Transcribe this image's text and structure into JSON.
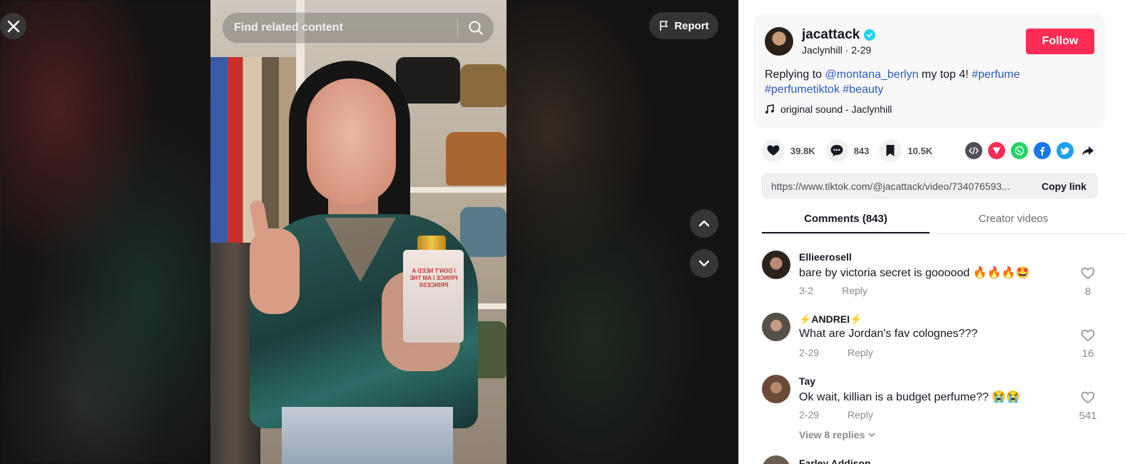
{
  "search": {
    "placeholder": "Find related content"
  },
  "report": {
    "label": "Report"
  },
  "video": {
    "bottle_text": "I DON'T NEED A PRINCE I AM THE PRINCESS"
  },
  "author": {
    "username": "jacattack",
    "display_name": "Jaclynhill",
    "date": "2-29",
    "subline": "Jaclynhill · 2-29",
    "follow_label": "Follow"
  },
  "caption": {
    "prefix": "Replying to ",
    "mention": "@montana_berlyn",
    "text": " my top 4! ",
    "tags": [
      "#perfume",
      "#perfumetiktok",
      "#beauty"
    ]
  },
  "sound": {
    "label": "original sound - Jaclynhill"
  },
  "stats": {
    "likes": "39.8K",
    "comments": "843",
    "saves": "10.5K"
  },
  "share": {
    "icons": [
      "embed-icon",
      "send-icon",
      "whatsapp-icon",
      "facebook-icon",
      "twitter-icon",
      "share-arrow-icon"
    ]
  },
  "link": {
    "url": "https://www.tiktok.com/@jacattack/video/734076593...",
    "copy_label": "Copy link"
  },
  "tabs": [
    {
      "label": "Comments (843)",
      "active": true
    },
    {
      "label": "Creator videos",
      "active": false
    }
  ],
  "comments": [
    {
      "name": "Ellieerosell",
      "text": "bare by victoria secret is goooood 🔥🔥🔥🤩",
      "date": "3-2",
      "reply": "Reply",
      "likes": "8"
    },
    {
      "name": "⚡ANDREI⚡",
      "text": "What are Jordan's fav colognes???",
      "date": "2-29",
      "reply": "Reply",
      "likes": "16"
    },
    {
      "name": "Tay",
      "text": "Ok wait, killian is a budget perfume?? 😭😭",
      "date": "2-29",
      "reply": "Reply",
      "likes": "541"
    }
  ],
  "view_replies": "View 8 replies",
  "next_comment_name": "Farley Addison"
}
